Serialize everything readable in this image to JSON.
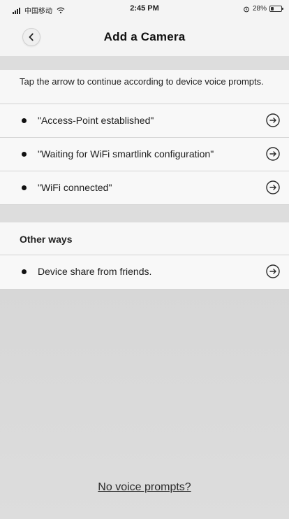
{
  "status_bar": {
    "carrier": "中国移动",
    "time": "2:45 PM",
    "battery_percent": "28%",
    "battery_level": 0.28,
    "icons": {
      "signal": "signal-bars-icon",
      "wifi": "wifi-icon",
      "alarm": "alarm-icon",
      "battery": "battery-icon"
    }
  },
  "nav": {
    "title": "Add a Camera",
    "back_icon": "chevron-left-icon"
  },
  "instruction": {
    "text": "Tap the arrow to continue according to device voice prompts."
  },
  "voice_prompts": [
    {
      "label": "\"Access-Point established\"",
      "arrow_icon": "arrow-right-circle-icon"
    },
    {
      "label": "\"Waiting for WiFi smartlink configuration\"",
      "arrow_icon": "arrow-right-circle-icon"
    },
    {
      "label": "\"WiFi connected\"",
      "arrow_icon": "arrow-right-circle-icon"
    }
  ],
  "other_ways": {
    "title": "Other ways",
    "items": [
      {
        "label": "Device share from friends.",
        "arrow_icon": "arrow-right-circle-icon"
      }
    ]
  },
  "footer": {
    "no_voice_link": "No voice prompts?"
  },
  "colors": {
    "background": "#d9d9d9",
    "card": "#f7f7f7",
    "text": "#1e1e1e"
  }
}
